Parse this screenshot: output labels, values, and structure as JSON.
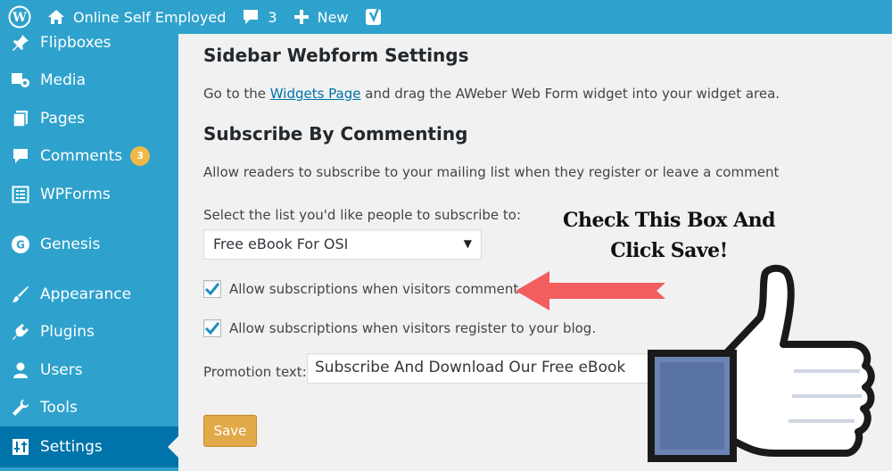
{
  "adminbar": {
    "site_name": "Online Self Employed",
    "comments_count": "3",
    "new_label": "New"
  },
  "sidebar": {
    "items": [
      {
        "label": "Flipboxes",
        "icon": "pin-icon"
      },
      {
        "label": "Media",
        "icon": "media-icon"
      },
      {
        "label": "Pages",
        "icon": "pages-icon"
      },
      {
        "label": "Comments",
        "icon": "comment-icon",
        "badge": "3"
      },
      {
        "label": "WPForms",
        "icon": "forms-icon"
      },
      {
        "label": "Genesis",
        "icon": "genesis-icon"
      },
      {
        "label": "Appearance",
        "icon": "brush-icon"
      },
      {
        "label": "Plugins",
        "icon": "plugin-icon"
      },
      {
        "label": "Users",
        "icon": "users-icon"
      },
      {
        "label": "Tools",
        "icon": "wrench-icon"
      },
      {
        "label": "Settings",
        "icon": "settings-icon",
        "current": true
      }
    ]
  },
  "main": {
    "webform_title": "Sidebar Webform Settings",
    "webform_text_before": "Go to the ",
    "webform_link": "Widgets Page",
    "webform_text_after": " and drag the AWeber Web Form widget into your widget area.",
    "subscribe_title": "Subscribe By Commenting",
    "subscribe_text": "Allow readers to subscribe to your mailing list when they register or leave a comment",
    "select_label": "Select the list you'd like people to subscribe to:",
    "select_value": "Free eBook For OSI",
    "checkbox_comment": {
      "label": "Allow subscriptions when visitors comment.",
      "checked": true
    },
    "checkbox_register": {
      "label": "Allow subscriptions when visitors register to your blog.",
      "checked": true
    },
    "promo_label": "Promotion text:",
    "promo_value": "Subscribe And Download Our Free eBook",
    "save_label": "Save"
  },
  "overlay": {
    "callout_line1": "Check This Box And",
    "callout_line2": "Click Save!"
  },
  "colors": {
    "sidebar": "#2ea2cc",
    "current": "#0073aa",
    "save": "#e1a948",
    "arrow": "#f45d5d",
    "thumb": "#6b83b5"
  }
}
